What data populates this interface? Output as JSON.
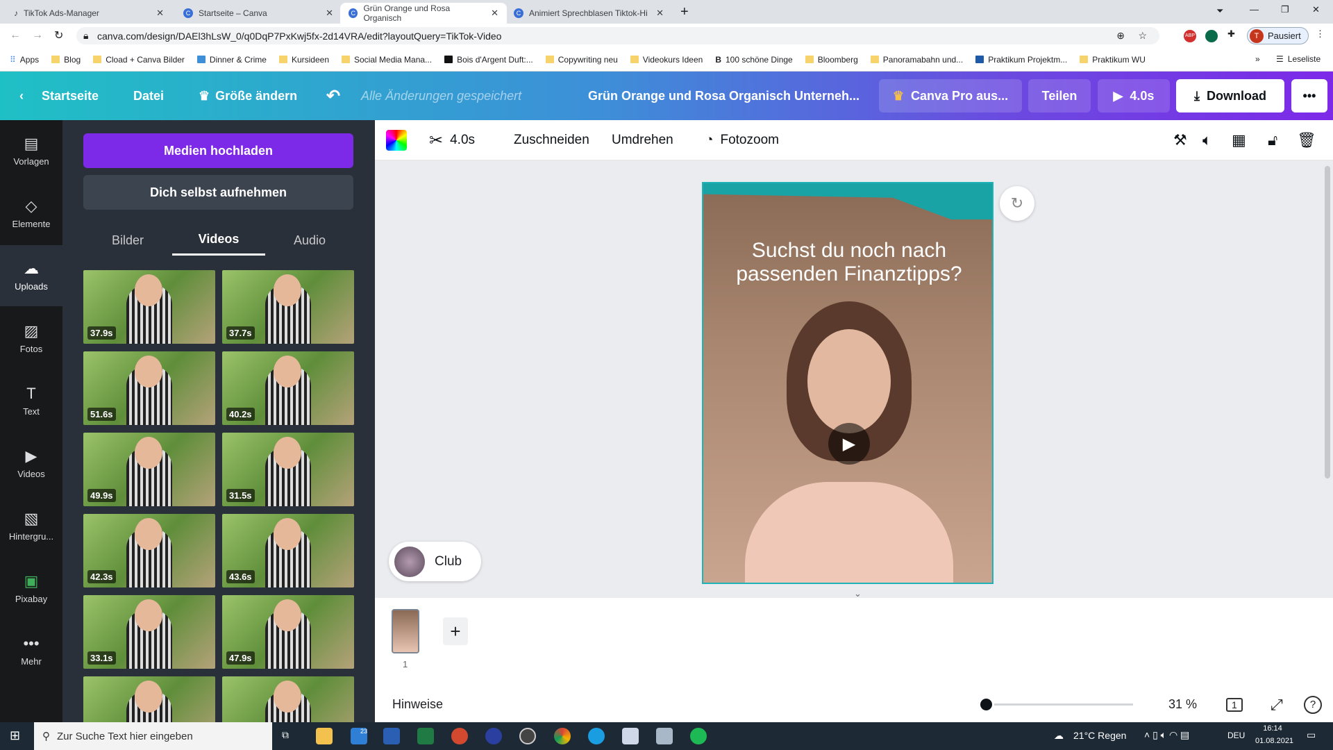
{
  "browser": {
    "tabs": [
      {
        "title": "TikTok Ads-Manager"
      },
      {
        "title": "Startseite – Canva"
      },
      {
        "title": "Grün Orange und Rosa Organisch"
      },
      {
        "title": "Animiert Sprechblasen Tiktok-Hi"
      }
    ],
    "url": "canva.com/design/DAEl3hLsW_0/q0DqP7PxKwj5fx-2d14VRA/edit?layoutQuery=TikTok-Video",
    "profile": "Pausiert",
    "bookmarks": [
      "Apps",
      "Blog",
      "Cload + Canva Bilder",
      "Dinner & Crime",
      "Kursideen",
      "Social Media Mana...",
      "Bois d'Argent Duft:...",
      "Copywriting neu",
      "Videokurs Ideen",
      "100 schöne Dinge",
      "Bloomberg",
      "Panoramabahn und...",
      "Praktikum Projektm...",
      "Praktikum WU"
    ],
    "reading_list": "Leseliste"
  },
  "header": {
    "home": "Startseite",
    "file": "Datei",
    "resize": "Größe ändern",
    "saved": "Alle Änderungen gespeichert",
    "title": "Grün Orange und Rosa Organisch Unterneh...",
    "pro": "Canva Pro aus...",
    "share": "Teilen",
    "play": "4.0s",
    "download": "Download",
    "more": "•••"
  },
  "rail": [
    {
      "label": "Vorlagen",
      "icon": "▤"
    },
    {
      "label": "Elemente",
      "icon": "◇"
    },
    {
      "label": "Uploads",
      "icon": "☁"
    },
    {
      "label": "Fotos",
      "icon": "▨"
    },
    {
      "label": "Text",
      "icon": "T"
    },
    {
      "label": "Videos",
      "icon": "▶"
    },
    {
      "label": "Hintergru...",
      "icon": "▧"
    },
    {
      "label": "Pixabay",
      "icon": "▣"
    },
    {
      "label": "Mehr",
      "icon": "•••"
    }
  ],
  "panel": {
    "upload": "Medien hochladen",
    "record": "Dich selbst aufnehmen",
    "tabs": [
      "Bilder",
      "Videos",
      "Audio"
    ],
    "videos": [
      "37.9s",
      "37.7s",
      "51.6s",
      "40.2s",
      "49.9s",
      "31.5s",
      "42.3s",
      "43.6s",
      "33.1s",
      "47.9s",
      "",
      ""
    ]
  },
  "toolbar": {
    "duration": "4.0s",
    "crop": "Zuschneiden",
    "flip": "Umdrehen",
    "photozoom": "Fotozoom"
  },
  "canvas": {
    "text": "Suchst du noch nach passenden Finanztipps?",
    "club": "Club"
  },
  "pages": {
    "number": "1"
  },
  "footer": {
    "notes": "Hinweise",
    "zoom": "31 %",
    "zoom_fraction": 0.31,
    "page_count": "1"
  },
  "taskbar": {
    "search": "Zur Suche Text hier eingeben",
    "weather": "21°C  Regen",
    "lang": "DEU",
    "time": "16:14",
    "date": "01.08.2021",
    "mail_badge": "23"
  }
}
